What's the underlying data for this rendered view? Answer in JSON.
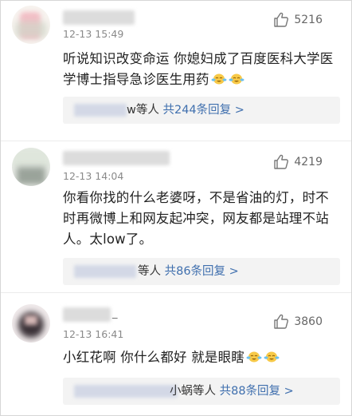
{
  "comments": [
    {
      "username_fragment": "",
      "time": "12-13 15:49",
      "likes": "5216",
      "text": "听说知识改变命运 你媳妇成了百度医科大学医学博士指导急诊医生用药",
      "reply": {
        "name_fragment": "w等人",
        "count_prefix": "共",
        "count": "244",
        "count_suffix": "条回复 >"
      }
    },
    {
      "username_fragment": "",
      "time": "12-13 14:04",
      "likes": "4219",
      "text": "你看你找的什么老婆呀，不是省油的灯，时不时再微博上和网友起冲突，网友都是站理不站人。太low了。",
      "reply": {
        "name_fragment": "等人",
        "count_prefix": "共",
        "count": "86",
        "count_suffix": "条回复 >"
      }
    },
    {
      "username_fragment": "_",
      "time": "12-13 16:41",
      "likes": "3860",
      "text": "小红花啊 你什么都好 就是眼瞎",
      "reply": {
        "name_fragment": "小蜗等人",
        "count_prefix": "共",
        "count": "88",
        "count_suffix": "条回复 >"
      }
    }
  ],
  "icons": {
    "like": "thumbs-up-icon",
    "emoji": "laughing-crying-emoji-icon"
  },
  "colors": {
    "link": "#3f6fae",
    "time": "#8a8a8a",
    "reply_bg": "#f3f3f3"
  }
}
